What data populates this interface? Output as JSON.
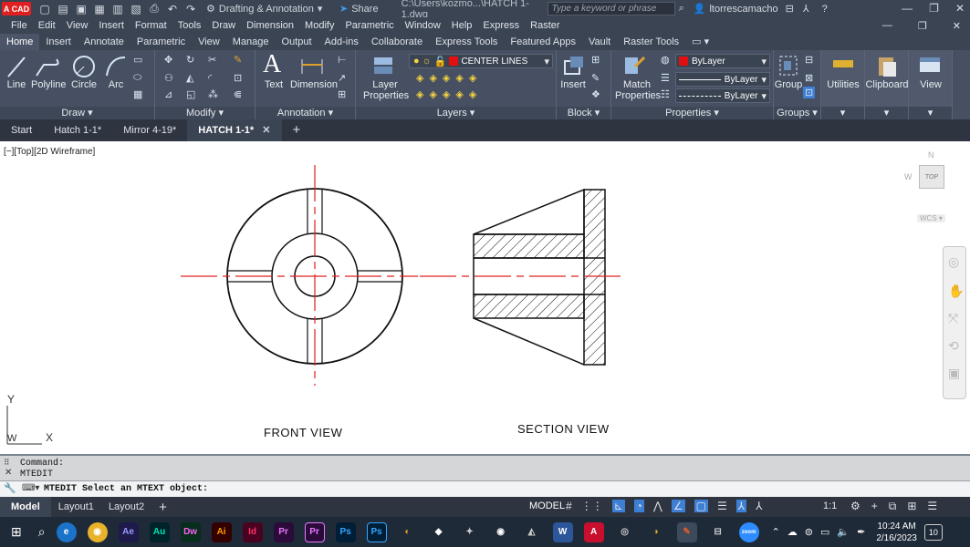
{
  "titlebar": {
    "logo": "A CAD",
    "workspace": "Drafting & Annotation",
    "share": "Share",
    "filepath": "C:\\Users\\kozmo...\\HATCH 1-1.dwg",
    "search_placeholder": "Type a keyword or phrase",
    "user": "ltorrescamacho"
  },
  "menu": [
    "File",
    "Edit",
    "View",
    "Insert",
    "Format",
    "Tools",
    "Draw",
    "Dimension",
    "Modify",
    "Parametric",
    "Window",
    "Help",
    "Express",
    "Raster"
  ],
  "ribbon_tabs": [
    "Home",
    "Insert",
    "Annotate",
    "Parametric",
    "View",
    "Manage",
    "Output",
    "Add-ins",
    "Collaborate",
    "Express Tools",
    "Featured Apps",
    "Vault",
    "Raster Tools"
  ],
  "ribbon": {
    "draw": {
      "title": "Draw",
      "line": "Line",
      "polyline": "Polyline",
      "circle": "Circle",
      "arc": "Arc"
    },
    "modify": {
      "title": "Modify"
    },
    "annotation": {
      "title": "Annotation",
      "text": "Text",
      "dimension": "Dimension"
    },
    "layers": {
      "title": "Layers",
      "layer_properties_1": "Layer",
      "layer_properties_2": "Properties",
      "current_layer": "CENTER LINES"
    },
    "block": {
      "title": "Block",
      "insert": "Insert"
    },
    "properties": {
      "title": "Properties",
      "match_1": "Match",
      "match_2": "Properties",
      "color": "ByLayer",
      "linetype": "ByLayer",
      "lineweight": "ByLayer"
    },
    "groups": {
      "title": "Groups",
      "group": "Group"
    },
    "utilities": "Utilities",
    "clipboard": "Clipboard",
    "view": "View"
  },
  "doc_tabs": {
    "start": "Start",
    "tabs": [
      "Hatch 1-1*",
      "Mirror 4-19*",
      "HATCH 1-1*"
    ]
  },
  "viewport": {
    "label": "[−][Top][2D Wireframe]",
    "front_view": "FRONT VIEW",
    "section_view": "SECTION VIEW",
    "ucs_y": "Y",
    "ucs_x": "X",
    "ucs_w": "W",
    "navcube": {
      "n": "N",
      "w": "W",
      "top": "TOP",
      "wcs": "WCS"
    }
  },
  "command": {
    "line1": "Command:",
    "line2": "MTEDIT",
    "prompt": "MTEDIT Select an MTEXT object:"
  },
  "status": {
    "tabs": [
      "Model",
      "Layout1",
      "Layout2"
    ],
    "model": "MODEL",
    "scale": "1:1"
  },
  "taskbar": {
    "time": "10:24 AM",
    "date": "2/16/2023",
    "badge": "10",
    "apps": [
      "Ae",
      "Au",
      "Dw",
      "Ai",
      "Id",
      "Pr",
      "Pr",
      "Ps",
      "Ps"
    ]
  },
  "colors": {
    "centerline": "#e02020",
    "ribbon_bg": "#465062",
    "accent": "#3d7fd4"
  }
}
